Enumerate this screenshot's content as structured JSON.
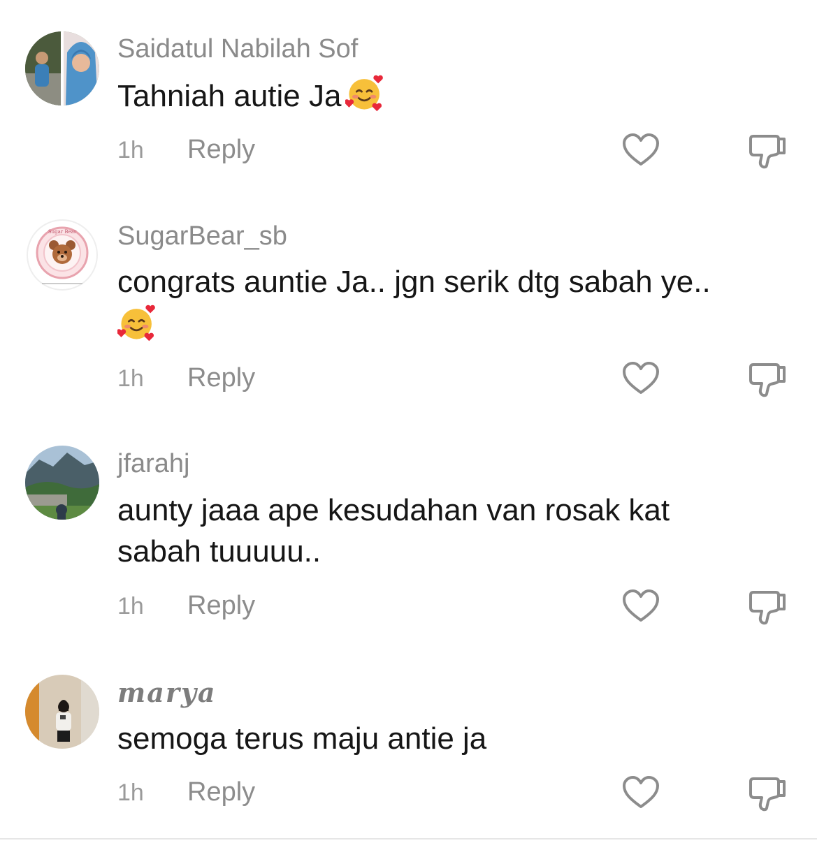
{
  "comments": [
    {
      "username": "Saidatul Nabilah Sof",
      "text": "Tahniah autie Ja",
      "emoji": "smiling-face-with-hearts",
      "time": "1h",
      "reply_label": "Reply"
    },
    {
      "username": "SugarBear_sb",
      "text": "congrats auntie Ja.. jgn serik dtg sabah ye..",
      "emoji": "smiling-face-with-hearts",
      "avatar_text": "Sugar Bear",
      "time": "1h",
      "reply_label": "Reply"
    },
    {
      "username": "jfarahj",
      "text": "aunty jaaa ape kesudahan van rosak kat sabah tuuuuu..",
      "time": "1h",
      "reply_label": "Reply"
    },
    {
      "username": "marya",
      "text": "semoga terus maju antie ja",
      "time": "1h",
      "reply_label": "Reply"
    }
  ],
  "icons": {
    "like": "heart-outline-icon",
    "dislike": "thumbs-down-outline-icon"
  },
  "colors": {
    "text": "#161616",
    "muted": "#8a8a8a",
    "icon": "#8c8c8c"
  }
}
